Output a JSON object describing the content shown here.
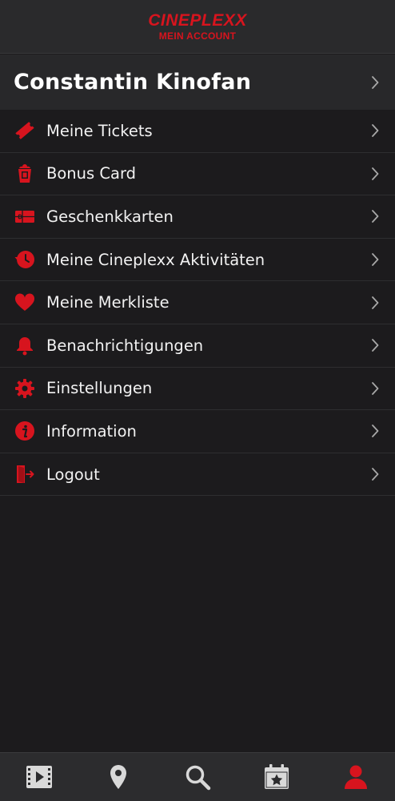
{
  "app": {
    "logo_text": "CINEPLEXX",
    "section_title": "MEIN ACCOUNT",
    "brand_color": "#d7141e"
  },
  "profile": {
    "name": "Constantin Kinofan",
    "icon": "chevron-right-icon"
  },
  "menu": {
    "items": [
      {
        "label": "Meine Tickets",
        "icon": "ticket-icon"
      },
      {
        "label": "Bonus Card",
        "icon": "popcorn-icon"
      },
      {
        "label": "Geschenkkarten",
        "icon": "gift-card-icon"
      },
      {
        "label": "Meine Cineplexx Aktivitäten",
        "icon": "history-icon"
      },
      {
        "label": "Meine Merkliste",
        "icon": "heart-icon"
      },
      {
        "label": "Benachrichtigungen",
        "icon": "bell-icon"
      },
      {
        "label": "Einstellungen",
        "icon": "gear-icon"
      },
      {
        "label": "Information",
        "icon": "info-icon"
      },
      {
        "label": "Logout",
        "icon": "logout-icon"
      }
    ]
  },
  "tabbar": {
    "tabs": [
      {
        "icon": "film-icon",
        "active": false
      },
      {
        "icon": "location-pin-icon",
        "active": false
      },
      {
        "icon": "search-icon",
        "active": false
      },
      {
        "icon": "calendar-star-icon",
        "active": false
      },
      {
        "icon": "user-icon",
        "active": true
      }
    ],
    "active_color": "#d7141e",
    "inactive_color": "#d9d9d9"
  }
}
